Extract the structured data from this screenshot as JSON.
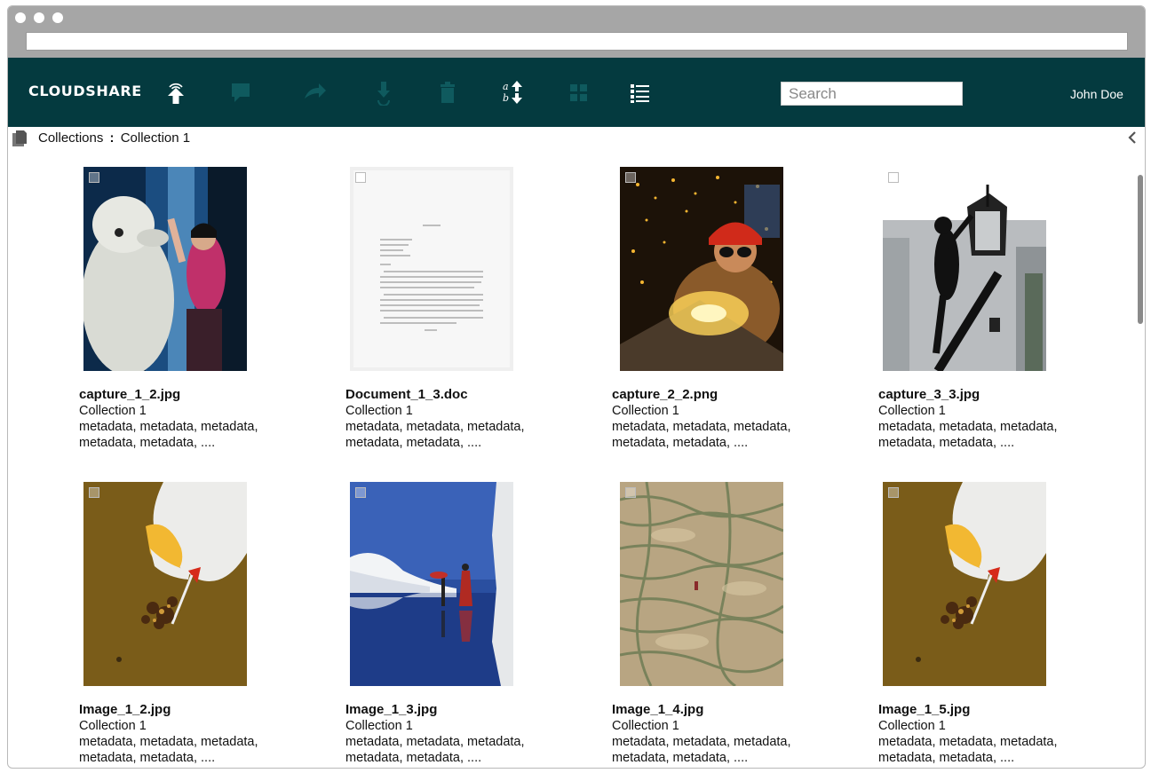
{
  "toolbar": {
    "logo": "CLOUDSHARE",
    "search_placeholder": "Search",
    "user_name": "John Doe",
    "icons": [
      "upload-icon",
      "comment-icon",
      "share-icon",
      "download-icon",
      "trash-icon",
      "sort-icon",
      "grid-view-icon",
      "list-view-icon"
    ]
  },
  "breadcrumb": {
    "root": "Collections",
    "separator": ":",
    "current": "Collection 1"
  },
  "items": [
    {
      "file": "capture_1_2.jpg",
      "collection": "Collection 1",
      "meta1": "metadata, metadata, metadata,",
      "meta2": "metadata, metadata, ...."
    },
    {
      "file": "Document_1_3.doc",
      "collection": "Collection 1",
      "meta1": "metadata, metadata, metadata,",
      "meta2": "metadata, metadata, ...."
    },
    {
      "file": "capture_2_2.png",
      "collection": "Collection 1",
      "meta1": "metadata, metadata, metadata,",
      "meta2": "metadata, metadata, ...."
    },
    {
      "file": "capture_3_3.jpg",
      "collection": "Collection 1",
      "meta1": "metadata, metadata, metadata,",
      "meta2": "metadata, metadata, ...."
    },
    {
      "file": "Image_1_2.jpg",
      "collection": "Collection 1",
      "meta1": "metadata, metadata, metadata,",
      "meta2": "metadata, metadata, ...."
    },
    {
      "file": "Image_1_3.jpg",
      "collection": "Collection 1",
      "meta1": "metadata, metadata, metadata,",
      "meta2": "metadata, metadata, ...."
    },
    {
      "file": "Image_1_4.jpg",
      "collection": "Collection 1",
      "meta1": "metadata, metadata, metadata,",
      "meta2": "metadata, metadata, ...."
    },
    {
      "file": "Image_1_5.jpg",
      "collection": "Collection 1",
      "meta1": "metadata, metadata, metadata,",
      "meta2": "metadata, metadata, ...."
    }
  ],
  "colors": {
    "toolbar_bg": "#043a3f",
    "chrome": "#a6a6a6",
    "disabled_icon": "#0f5a5e"
  }
}
